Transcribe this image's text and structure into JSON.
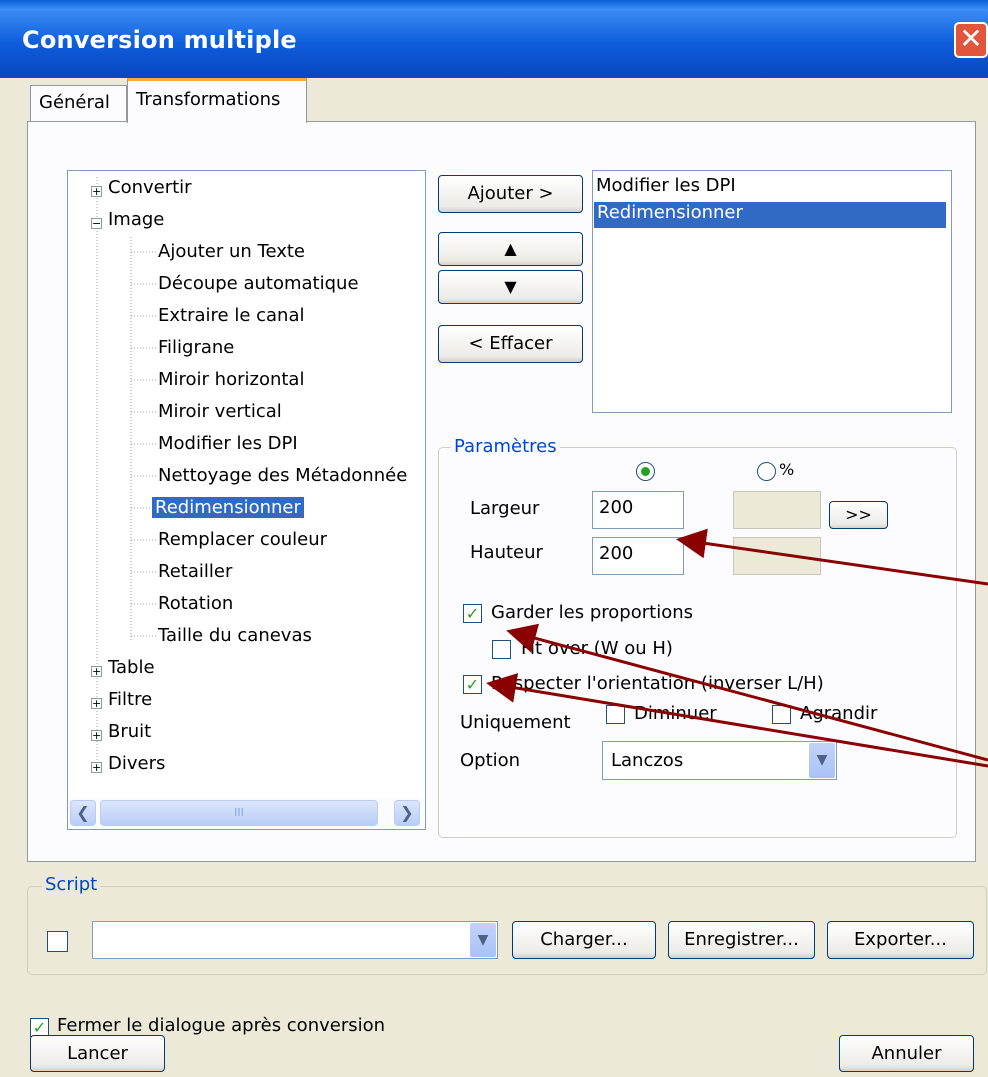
{
  "window": {
    "title": "Conversion multiple",
    "close_label": "✕"
  },
  "tabs": [
    {
      "label": "Général",
      "active": false
    },
    {
      "label": "Transformations",
      "active": true
    }
  ],
  "tree": {
    "items": [
      {
        "label": "Convertir",
        "expander": "+"
      },
      {
        "label": "Image",
        "expander": "−"
      },
      {
        "label": "Ajouter un Texte"
      },
      {
        "label": "Découpe automatique"
      },
      {
        "label": "Extraire le canal"
      },
      {
        "label": "Filigrane"
      },
      {
        "label": "Miroir horizontal"
      },
      {
        "label": "Miroir vertical"
      },
      {
        "label": "Modifier les DPI"
      },
      {
        "label": "Nettoyage des Métadonnée"
      },
      {
        "label": "Redimensionner",
        "selected": true
      },
      {
        "label": "Remplacer couleur"
      },
      {
        "label": "Retailler"
      },
      {
        "label": "Rotation"
      },
      {
        "label": "Taille du canevas"
      },
      {
        "label": "Table",
        "expander": "+"
      },
      {
        "label": "Filtre",
        "expander": "+"
      },
      {
        "label": "Bruit",
        "expander": "+"
      },
      {
        "label": "Divers",
        "expander": "+"
      }
    ],
    "scroll_grip": "III"
  },
  "buttons": {
    "add": "Ajouter >",
    "up": "▲",
    "down": "▼",
    "remove": "< Effacer",
    "more": ">>",
    "load": "Charger...",
    "save": "Enregistrer...",
    "export": "Exporter...",
    "run": "Lancer",
    "cancel": "Annuler"
  },
  "selected_list": {
    "items": [
      "Modifier les DPI",
      "Redimensionner"
    ],
    "selected_index": 1
  },
  "params": {
    "legend": "Paramètres",
    "percent_symbol": "%",
    "width_label": "Largeur",
    "height_label": "Hauteur",
    "width_value": "200",
    "height_value": "200",
    "keep_ratio": "Garder les proportions",
    "fit_over": "Fit over (W ou H)",
    "respect_orientation": "Respecter l'orientation (inverser L/H)",
    "only_label": "Uniquement",
    "decrease": "Diminuer",
    "increase": "Agrandir",
    "option_label": "Option",
    "option_value": "Lanczos"
  },
  "script": {
    "legend": "Script",
    "value": ""
  },
  "close_after": "Fermer le dialogue après conversion",
  "colors": {
    "titlebar": "#0A5FD8",
    "selection": "#316AC5",
    "arrow": "#8B0000",
    "group_legend": "#0046D5"
  }
}
